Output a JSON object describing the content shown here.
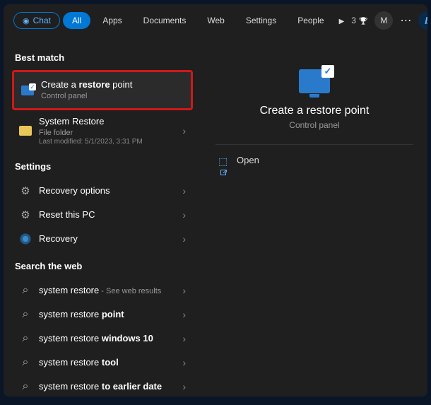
{
  "tabs": {
    "chat": "Chat",
    "all": "All",
    "apps": "Apps",
    "documents": "Documents",
    "web": "Web",
    "settings": "Settings",
    "people": "People"
  },
  "rewards": {
    "count": "3"
  },
  "user_initial": "M",
  "sections": {
    "best_match": "Best match",
    "settings": "Settings",
    "search_web": "Search the web"
  },
  "best_match": {
    "item1": {
      "pre": "Create a ",
      "bold": "restore",
      "post": " point",
      "sub": "Control panel"
    },
    "item2": {
      "title": "System Restore",
      "sub": "File folder",
      "meta": "Last modified: 5/1/2023, 3:31 PM"
    }
  },
  "settings_items": {
    "r1": "Recovery options",
    "r2": "Reset this PC",
    "r3": "Recovery"
  },
  "web_items": {
    "w1": {
      "pre": "system restore",
      "suffix": " - See web results"
    },
    "w2": {
      "pre": "system restore ",
      "bold": "point"
    },
    "w3": {
      "pre": "system restore ",
      "bold": "windows 10"
    },
    "w4": {
      "pre": "system restore ",
      "bold": "tool"
    },
    "w5": {
      "pre": "system restore ",
      "bold": "to earlier date"
    }
  },
  "preview": {
    "title": "Create a restore point",
    "sub": "Control panel",
    "actions": {
      "open": "Open"
    }
  }
}
